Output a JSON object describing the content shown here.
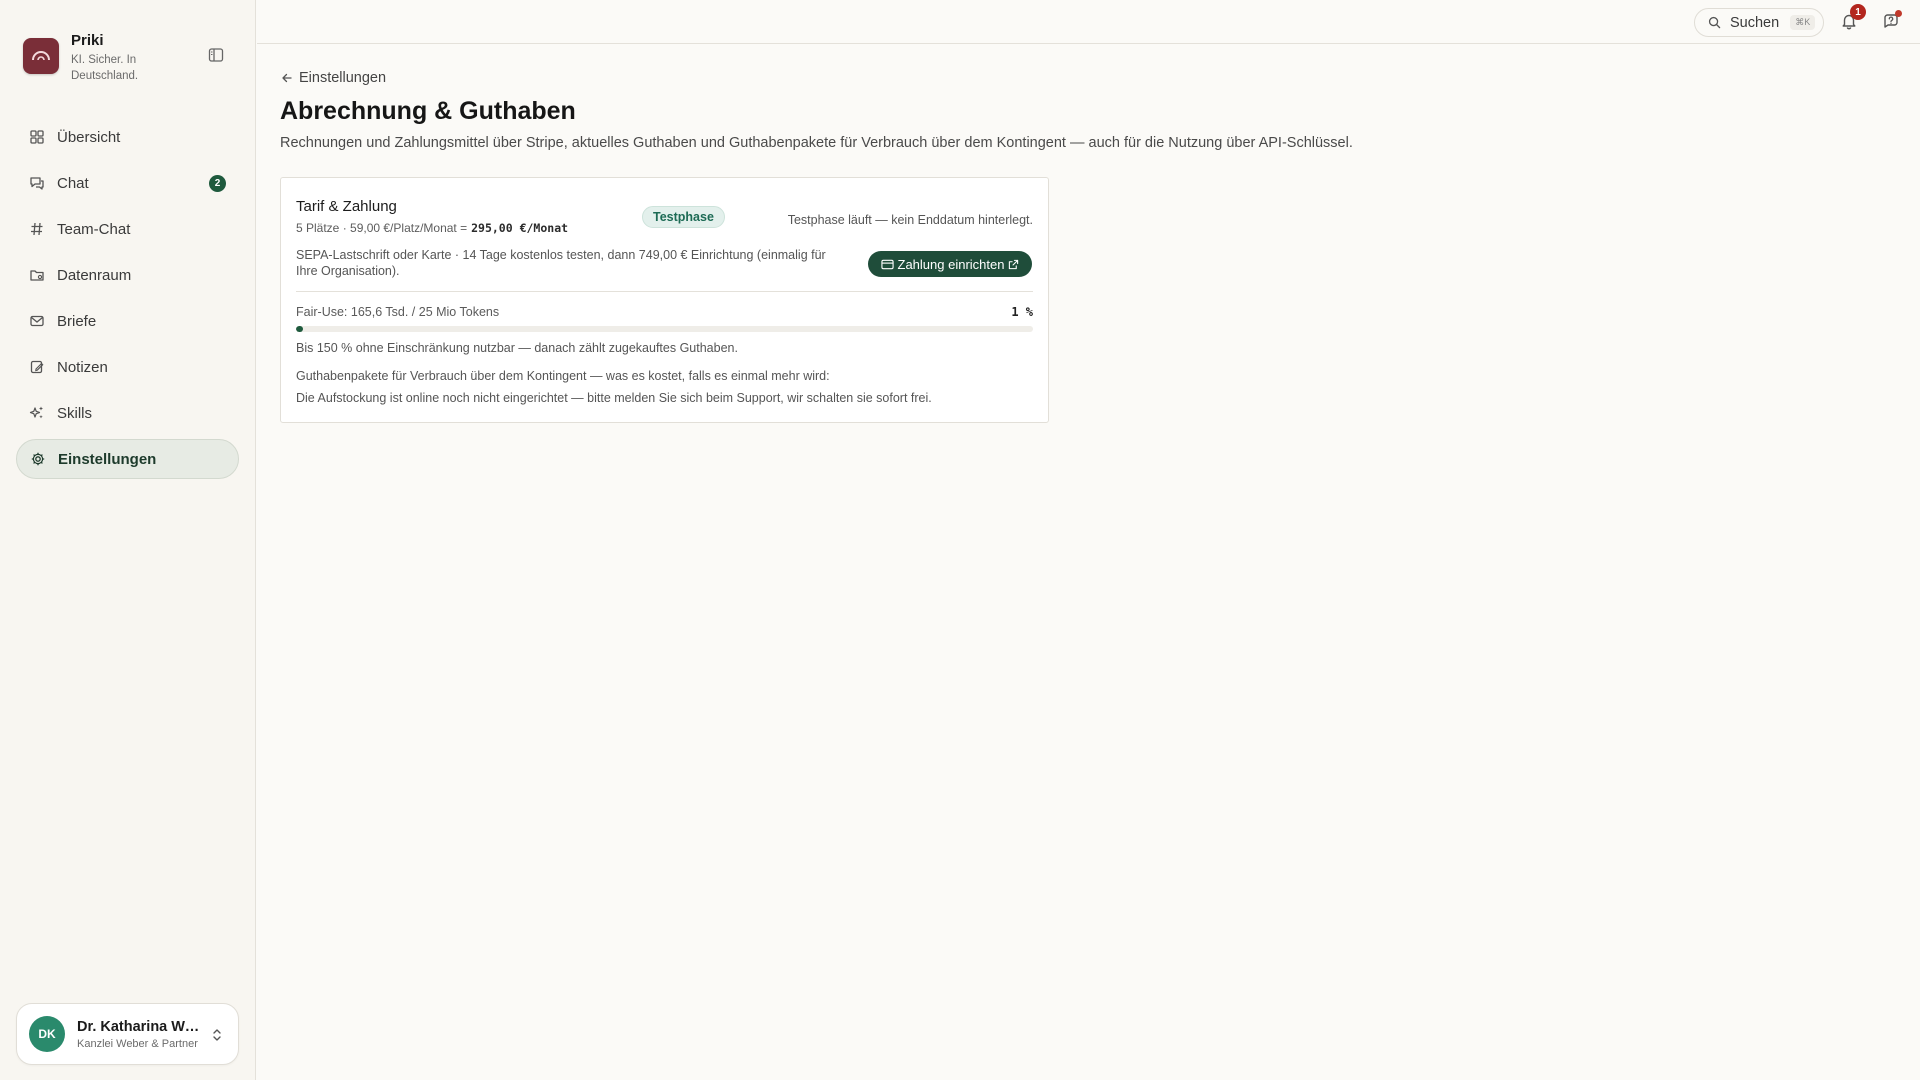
{
  "brand": {
    "name": "Priki",
    "tagline": "KI. Sicher. In Deutschland."
  },
  "sidebar": {
    "items": [
      {
        "label": "Übersicht",
        "icon": "grid-icon"
      },
      {
        "label": "Chat",
        "icon": "chat-icon",
        "badge": "2"
      },
      {
        "label": "Team-Chat",
        "icon": "hash-icon"
      },
      {
        "label": "Datenraum",
        "icon": "folder-icon"
      },
      {
        "label": "Briefe",
        "icon": "mail-icon"
      },
      {
        "label": "Notizen",
        "icon": "note-icon"
      },
      {
        "label": "Skills",
        "icon": "sparkle-icon"
      },
      {
        "label": "Einstellungen",
        "icon": "gear-icon",
        "active": true
      }
    ]
  },
  "user": {
    "initials": "DK",
    "name": "Dr. Katharina Weber",
    "org": "Kanzlei Weber & Partner"
  },
  "topbar": {
    "search_label": "Suchen",
    "search_shortcut": "⌘K",
    "notifications_count": "1"
  },
  "page": {
    "back_label": "Einstellungen",
    "title": "Abrechnung & Guthaben",
    "description": "Rechnungen und Zahlungsmittel über Stripe, aktuelles Guthaben und Guthabenpakete für Verbrauch über dem Kontingent — auch für die Nutzung über API-Schlüssel."
  },
  "billing": {
    "plan_title": "Tarif & Zahlung",
    "plan_details": "5 Plätze · 59,00 €/Platz/Monat =",
    "plan_total": "295,00 €/Monat",
    "status_badge": "Testphase",
    "trial_note": "Testphase läuft — kein Enddatum hinterlegt.",
    "payment_methods_text": "SEPA-Lastschrift oder Karte · 14 Tage kostenlos testen, dann 749,00 € Einrichtung (einmalig für Ihre Organisation).",
    "pay_button_label": "Zahlung einrichten",
    "fair_use_label": "Fair-Use: 165,6 Tsd. / 25 Mio Tokens",
    "fair_use_percent_label": "1 %",
    "fair_use_fraction": 0.01,
    "fair_use_note": "Bis 150 % ohne Einschränkung nutzbar — danach zählt zugekauftes Guthaben.",
    "packages_heading": "Guthabenpakete für Verbrauch über dem Kontingent — was es kostet, falls es einmal mehr wird:",
    "packages_note": "Die Aufstockung ist online noch nicht eingerichtet — bitte melden Sie sich beim Support, wir schalten sie sofort frei."
  },
  "colors": {
    "accent": "#1f5a3d",
    "brand": "#7a2e38",
    "alert": "#b3261e"
  }
}
